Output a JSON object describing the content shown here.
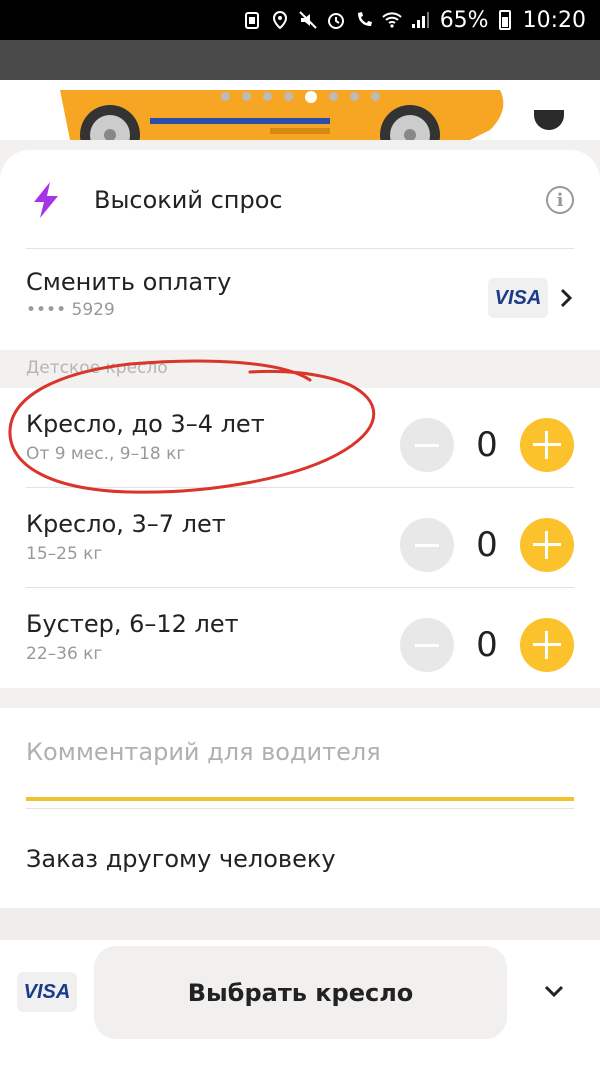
{
  "status_bar": {
    "battery_percent": "65%",
    "time": "10:20"
  },
  "carousel": {
    "dot_count": 8,
    "active_index": 4
  },
  "demand": {
    "title": "Высокий спрос",
    "info_icon": "info-icon",
    "accent_color": "#a633e8"
  },
  "payment": {
    "title": "Сменить оплату",
    "card_masked": "•••• 5929",
    "card_brand": "VISA"
  },
  "child_seat_section": {
    "label": "Детское кресло",
    "items": [
      {
        "title": "Кресло, до 3–4 лет",
        "sub": "От 9 мес., 9–18 кг",
        "count": "0"
      },
      {
        "title": "Кресло, 3–7 лет",
        "sub": "15–25 кг",
        "count": "0"
      },
      {
        "title": "Бустер, 6–12 лет",
        "sub": "22–36 кг",
        "count": "0"
      }
    ]
  },
  "comment": {
    "placeholder": "Комментарий для водителя"
  },
  "order_for_other": {
    "label": "Заказ другому человеку"
  },
  "bottom": {
    "card_brand": "VISA",
    "main_button": "Выбрать кресло"
  },
  "colors": {
    "accent_yellow": "#fbc22b",
    "annotation_red": "#d9352b"
  }
}
